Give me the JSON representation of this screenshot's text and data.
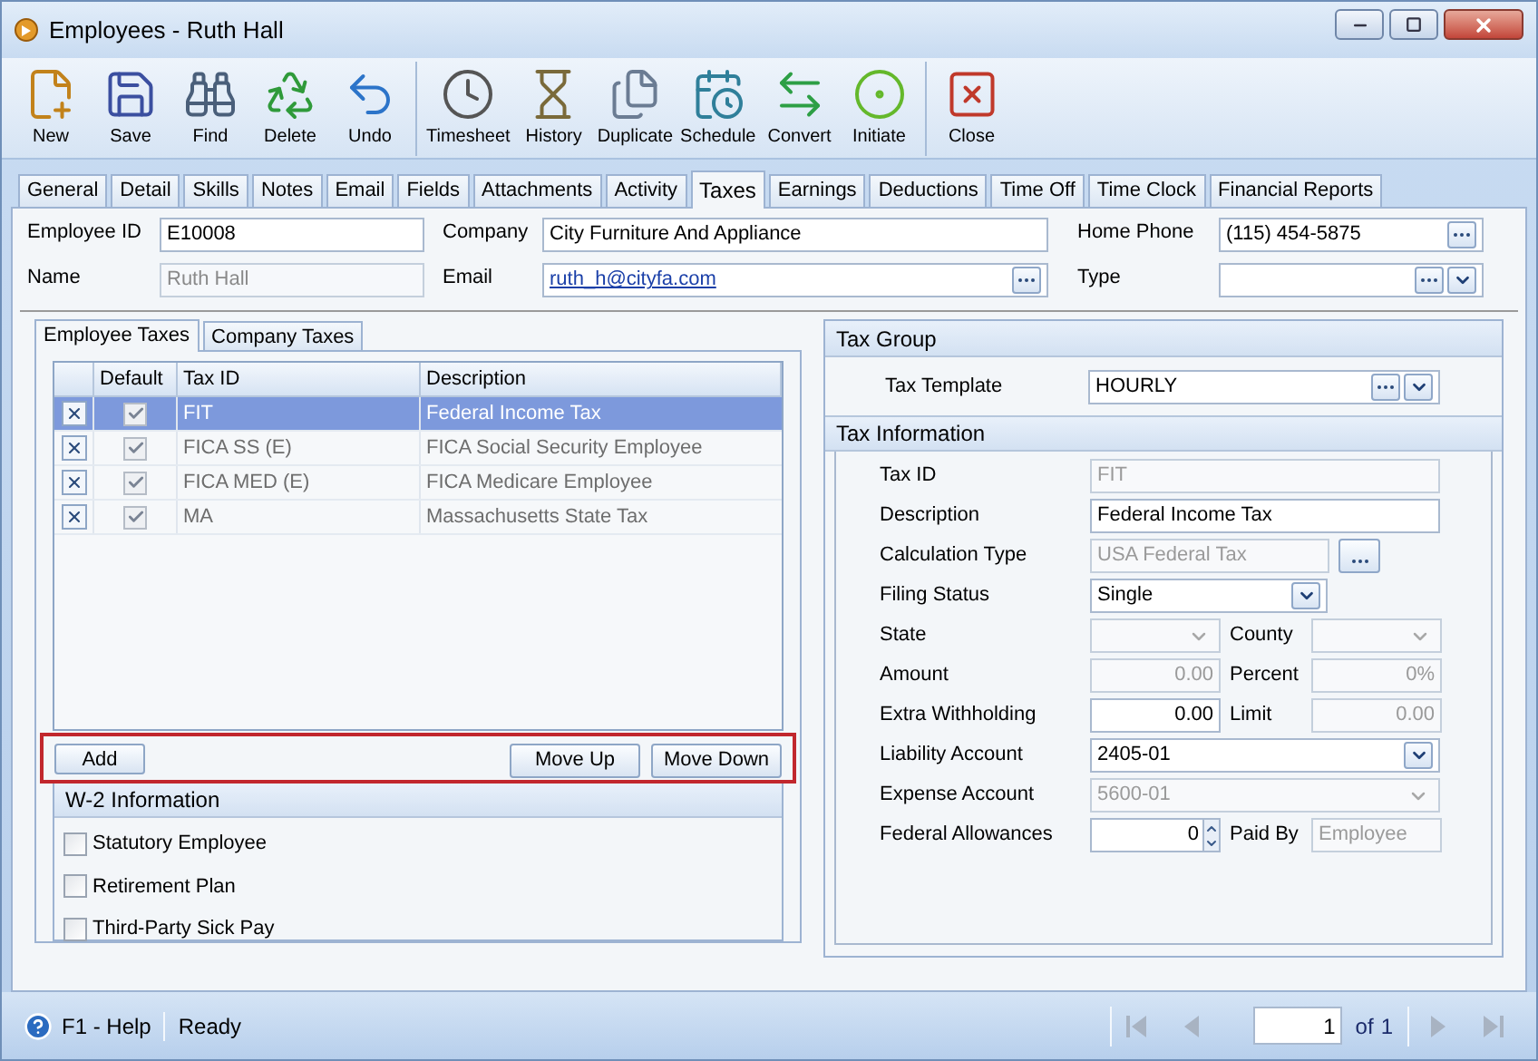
{
  "window": {
    "title": "Employees - Ruth Hall"
  },
  "toolbar": [
    [
      {
        "label": "New"
      },
      {
        "label": "Save"
      },
      {
        "label": "Find"
      },
      {
        "label": "Delete"
      },
      {
        "label": "Undo"
      }
    ],
    [
      {
        "label": "Timesheet"
      },
      {
        "label": "History"
      },
      {
        "label": "Duplicate"
      },
      {
        "label": "Schedule"
      },
      {
        "label": "Convert"
      },
      {
        "label": "Initiate"
      }
    ],
    [
      {
        "label": "Close"
      }
    ]
  ],
  "tabs": [
    {
      "label": "General",
      "selected": false
    },
    {
      "label": "Detail",
      "selected": false
    },
    {
      "label": "Skills",
      "selected": false
    },
    {
      "label": "Notes",
      "selected": false
    },
    {
      "label": "Email",
      "selected": false
    },
    {
      "label": "Fields",
      "selected": false
    },
    {
      "label": "Attachments",
      "selected": false
    },
    {
      "label": "Activity",
      "selected": false
    },
    {
      "label": "Taxes",
      "selected": true
    },
    {
      "label": "Earnings",
      "selected": false
    },
    {
      "label": "Deductions",
      "selected": false
    },
    {
      "label": "Time Off",
      "selected": false
    },
    {
      "label": "Time Clock",
      "selected": false
    },
    {
      "label": "Financial Reports",
      "selected": false
    }
  ],
  "header_fields": [
    {
      "label": "Employee ID",
      "value": "E10008",
      "kind": "text",
      "disabled": false
    },
    {
      "label": "Company",
      "value": "City Furniture And Appliance",
      "kind": "text",
      "disabled": false
    },
    {
      "label": "Home Phone",
      "value": "(115) 454-5875",
      "kind": "lookup",
      "disabled": false
    },
    {
      "label": "Name",
      "value": "Ruth Hall",
      "kind": "text",
      "disabled": true
    },
    {
      "label": "Email",
      "value": "ruth_h@cityfa.com",
      "kind": "link_lookup",
      "disabled": false
    },
    {
      "label": "Type",
      "kind": "combo_lookup",
      "disabled": false
    }
  ],
  "sub_tabs": [
    {
      "label": "Employee Taxes",
      "selected": true
    },
    {
      "label": "Company Taxes",
      "selected": false
    }
  ],
  "tax_grid": {
    "columns": [
      "Default",
      "Tax ID",
      "Description"
    ],
    "rows": [
      {
        "default": true,
        "tax_id": "FIT",
        "description": "Federal Income Tax",
        "selected": true
      },
      {
        "default": true,
        "tax_id": "FICA SS (E)",
        "description": "FICA Social Security Employee",
        "selected": false
      },
      {
        "default": true,
        "tax_id": "FICA MED (E)",
        "description": "FICA Medicare Employee",
        "selected": false
      },
      {
        "default": true,
        "tax_id": "MA",
        "description": "Massachusetts State Tax",
        "selected": false
      }
    ]
  },
  "grid_buttons": {
    "add": "Add",
    "move_up": "Move Up",
    "move_down": "Move Down"
  },
  "w2": {
    "title": "W-2 Information",
    "items": [
      {
        "label": "Statutory Employee",
        "checked": false
      },
      {
        "label": "Retirement Plan",
        "checked": false
      },
      {
        "label": "Third-Party Sick Pay",
        "checked": false
      }
    ]
  },
  "tax_group": {
    "title": "Tax Group",
    "label": "Tax Template",
    "value": "HOURLY"
  },
  "tax_info": {
    "title": "Tax Information",
    "rows": [
      [
        {
          "label": "Tax ID",
          "value": "FIT",
          "kind": "text",
          "disabled": true
        }
      ],
      [
        {
          "label": "Description",
          "value": "Federal Income Tax",
          "kind": "text",
          "disabled": false
        }
      ],
      [
        {
          "label": "Calculation Type",
          "value": "USA Federal Tax",
          "kind": "lookup",
          "disabled": true
        }
      ],
      [
        {
          "label": "Filing Status",
          "value": "Single",
          "kind": "short_dropdown",
          "disabled": false
        }
      ],
      [
        {
          "label": "State",
          "kind": "dropdown",
          "disabled": true
        },
        {
          "label": "County",
          "kind": "dropdown",
          "disabled": true
        }
      ],
      [
        {
          "label": "Amount",
          "value": "0.00",
          "kind": "number",
          "disabled": true
        },
        {
          "label": "Percent",
          "value": "0%",
          "kind": "number",
          "disabled": true
        }
      ],
      [
        {
          "label": "Extra Withholding",
          "value": "0.00",
          "kind": "number",
          "disabled": false
        },
        {
          "label": "Limit",
          "value": "0.00",
          "kind": "number",
          "disabled": true
        }
      ],
      [
        {
          "label": "Liability Account",
          "value": "2405-01",
          "kind": "dropdown",
          "disabled": false
        }
      ],
      [
        {
          "label": "Expense Account",
          "value": "5600-01",
          "kind": "dropdown",
          "disabled": true
        }
      ],
      [
        {
          "label": "Federal Allowances",
          "value": "0",
          "kind": "spinner",
          "disabled": false
        },
        {
          "label": "Paid By",
          "value": "Employee",
          "kind": "text",
          "disabled": true
        }
      ]
    ]
  },
  "status_bar": {
    "help": "F1 - Help",
    "status": "Ready",
    "page": "1",
    "of_label": "of",
    "total": "1"
  }
}
